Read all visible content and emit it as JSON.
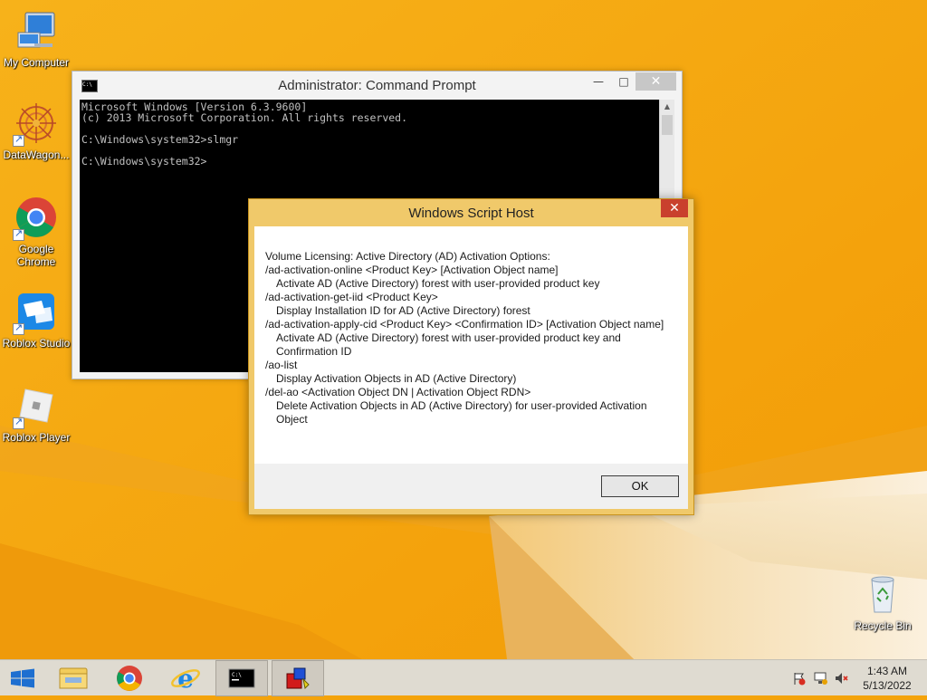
{
  "desktop": {
    "icons": [
      {
        "label": "My Computer",
        "icon": "computer-icon"
      },
      {
        "label": "DataWagon...",
        "icon": "datawagon-icon"
      },
      {
        "label": "Google Chrome",
        "icon": "chrome-icon"
      },
      {
        "label": "Roblox Studio",
        "icon": "roblox-studio-icon"
      },
      {
        "label": "Roblox Player",
        "icon": "roblox-player-icon"
      },
      {
        "label": "Recycle Bin",
        "icon": "recycle-bin-icon"
      }
    ]
  },
  "cmd_window": {
    "title": "Administrator: Command Prompt",
    "lines": [
      "Microsoft Windows [Version 6.3.9600]",
      "(c) 2013 Microsoft Corporation. All rights reserved.",
      "",
      "C:\\Windows\\system32>slmgr",
      "",
      "C:\\Windows\\system32>"
    ]
  },
  "dialog": {
    "title": "Windows Script Host",
    "lines": [
      {
        "text": "Volume Licensing: Active Directory (AD) Activation Options:",
        "indent": false
      },
      {
        "text": "/ad-activation-online <Product Key> [Activation Object name]",
        "indent": false
      },
      {
        "text": "Activate AD (Active Directory) forest with user-provided product key",
        "indent": true
      },
      {
        "text": "/ad-activation-get-iid <Product Key>",
        "indent": false
      },
      {
        "text": "Display Installation ID for AD (Active Directory) forest",
        "indent": true
      },
      {
        "text": "/ad-activation-apply-cid <Product Key> <Confirmation ID> [Activation Object name]",
        "indent": false
      },
      {
        "text": "Activate AD (Active Directory) forest with user-provided product key and Confirmation ID",
        "indent": true
      },
      {
        "text": "/ao-list",
        "indent": false
      },
      {
        "text": "Display Activation Objects in AD (Active Directory)",
        "indent": true
      },
      {
        "text": "/del-ao <Activation Object DN | Activation Object RDN>",
        "indent": false
      },
      {
        "text": "Delete Activation Objects in AD (Active Directory) for user-provided Activation Object",
        "indent": true
      }
    ],
    "ok_label": "OK"
  },
  "taskbar": {
    "time": "1:43 AM",
    "date": "5/13/2022",
    "colors": {
      "desktop": "#f4a30b",
      "taskbar": "#dfdbd1",
      "close_red": "#c9402d"
    }
  }
}
